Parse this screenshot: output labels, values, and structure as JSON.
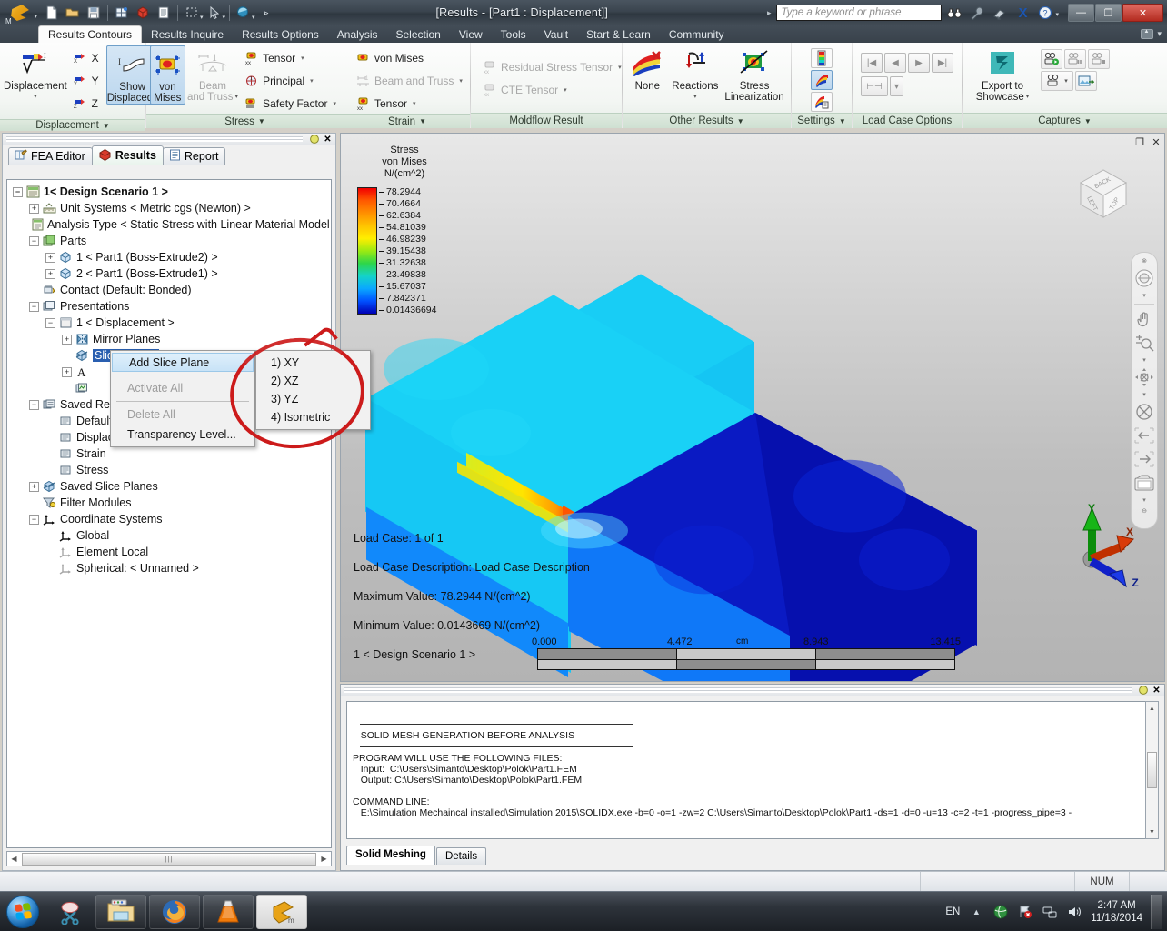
{
  "window": {
    "title": "[Results - [Part1 : Displacement]]",
    "app_icon": "autodesk-logo",
    "minimize_label": "—",
    "restore_label": "❐",
    "close_label": "✕"
  },
  "quick_access": [
    {
      "name": "new-file-icon",
      "glyph": "🗋"
    },
    {
      "name": "open-file-icon",
      "glyph": "🗁"
    },
    {
      "name": "save-icon",
      "glyph": "💾"
    },
    {
      "name": "mesh-icon",
      "glyph": "▦"
    },
    {
      "name": "model-cube-icon",
      "glyph": "◼"
    },
    {
      "name": "report-icon",
      "glyph": "▤"
    },
    {
      "name": "select-rect-icon",
      "glyph": "⬚"
    },
    {
      "name": "select-arrow-icon",
      "glyph": "➤"
    },
    {
      "name": "analysis-icon",
      "glyph": "◕"
    }
  ],
  "search": {
    "placeholder": "Type a keyword or phrase",
    "icons": [
      "binoculars-icon",
      "wrench-icon",
      "satellite-icon",
      "exchange-icon",
      "help-icon"
    ]
  },
  "ribbon_tabs": [
    {
      "label": "Results Contours",
      "active": true
    },
    {
      "label": "Results Inquire",
      "active": false
    },
    {
      "label": "Results Options",
      "active": false
    },
    {
      "label": "Analysis",
      "active": false
    },
    {
      "label": "Selection",
      "active": false
    },
    {
      "label": "View",
      "active": false
    },
    {
      "label": "Tools",
      "active": false
    },
    {
      "label": "Vault",
      "active": false
    },
    {
      "label": "Start & Learn",
      "active": false
    },
    {
      "label": "Community",
      "active": false
    }
  ],
  "ribbon_groups": {
    "displacement": {
      "title": "Displacement",
      "main_button": "Displacement",
      "axes": [
        "X",
        "Y",
        "Z"
      ],
      "show_displaced": "Show\nDisplaced",
      "show_displaced_line1": "Show",
      "show_displaced_line2": "Displaced"
    },
    "stress": {
      "title": "Stress",
      "von_mises_l1": "von",
      "von_mises_l2": "Mises",
      "beam_truss_l1": "Beam",
      "beam_truss_l2": "and Truss",
      "items": [
        "Tensor",
        "Principal",
        "Safety Factor"
      ]
    },
    "strain": {
      "title": "Strain",
      "items": [
        "von Mises",
        "Beam and Truss",
        "Tensor"
      ]
    },
    "moldflow": {
      "title": "Moldflow Result",
      "items": [
        "Residual Stress Tensor",
        "CTE Tensor"
      ]
    },
    "other_results": {
      "title": "Other Results",
      "none": "None",
      "reactions": "Reactions",
      "stress_lin_l1": "Stress",
      "stress_lin_l2": "Linearization"
    },
    "settings": {
      "title": "Settings"
    },
    "load_case_options": {
      "title": "Load Case Options"
    },
    "captures": {
      "title": "Captures",
      "export_l1": "Export to",
      "export_l2": "Showcase"
    }
  },
  "tree_panel": {
    "tabs": [
      {
        "label": "FEA Editor",
        "icon": "fea-editor-icon",
        "active": false
      },
      {
        "label": "Results",
        "icon": "results-cube-icon",
        "active": true
      },
      {
        "label": "Report",
        "icon": "report-icon",
        "active": false
      }
    ],
    "nodes": [
      {
        "label": "1< Design Scenario 1 >",
        "indent": 0,
        "expander": "-",
        "icon": "scenario-icon",
        "bold": true
      },
      {
        "label": "Unit Systems < Metric cgs (Newton) >",
        "indent": 1,
        "expander": "+",
        "icon": "units-icon"
      },
      {
        "label": "Analysis Type < Static Stress with Linear Material Model",
        "indent": 1,
        "expander": "",
        "icon": "analysis-type-icon"
      },
      {
        "label": "Parts",
        "indent": 1,
        "expander": "-",
        "icon": "parts-icon"
      },
      {
        "label": "1 < Part1 (Boss-Extrude2) >",
        "indent": 2,
        "expander": "+",
        "icon": "part-cube-icon"
      },
      {
        "label": "2 < Part1 (Boss-Extrude1) >",
        "indent": 2,
        "expander": "+",
        "icon": "part-cube-icon"
      },
      {
        "label": "Contact (Default: Bonded)",
        "indent": 1,
        "expander": "",
        "icon": "contact-icon"
      },
      {
        "label": "Presentations",
        "indent": 1,
        "expander": "-",
        "icon": "presentations-icon"
      },
      {
        "label": "1 < Displacement >",
        "indent": 2,
        "expander": "-",
        "icon": "presentation-icon"
      },
      {
        "label": "Mirror Planes",
        "indent": 3,
        "expander": "+",
        "icon": "mirror-planes-icon"
      },
      {
        "label": "Slice Planes",
        "indent": 3,
        "expander": "",
        "icon": "slice-planes-icon",
        "selected": true
      },
      {
        "label": "",
        "indent": 3,
        "expander": "+",
        "icon": "text-a-icon"
      },
      {
        "label": "",
        "indent": 3,
        "expander": "",
        "icon": "graph-icon"
      },
      {
        "label": "Saved Reports",
        "indent": 1,
        "expander": "-",
        "icon": "saved-reports-icon"
      },
      {
        "label": "Default",
        "indent": 2,
        "expander": "",
        "icon": "report-item-icon"
      },
      {
        "label": "Displacement",
        "indent": 2,
        "expander": "",
        "icon": "report-item-icon"
      },
      {
        "label": "Strain",
        "indent": 2,
        "expander": "",
        "icon": "report-item-icon"
      },
      {
        "label": "Stress",
        "indent": 2,
        "expander": "",
        "icon": "report-item-icon"
      },
      {
        "label": "Saved Slice Planes",
        "indent": 1,
        "expander": "+",
        "icon": "slice-planes-icon"
      },
      {
        "label": "Filter Modules",
        "indent": 1,
        "expander": "",
        "icon": "filter-icon"
      },
      {
        "label": "Coordinate Systems",
        "indent": 1,
        "expander": "-",
        "icon": "coord-sys-icon"
      },
      {
        "label": "Global",
        "indent": 2,
        "expander": "",
        "icon": "coord-sys-icon"
      },
      {
        "label": "Element Local",
        "indent": 2,
        "expander": "",
        "icon": "coord-sys-gray-icon"
      },
      {
        "label": "Spherical: < Unnamed >",
        "indent": 2,
        "expander": "",
        "icon": "coord-sys-gray-icon"
      }
    ]
  },
  "context_menu": {
    "items": [
      {
        "label": "Add Slice Plane",
        "highlighted": true,
        "disabled": false,
        "accel": "S"
      },
      {
        "separator": true
      },
      {
        "label": "Activate All",
        "highlighted": false,
        "disabled": true,
        "accel": "A"
      },
      {
        "separator": true
      },
      {
        "label": "Delete All",
        "highlighted": false,
        "disabled": true,
        "accel": "l"
      },
      {
        "label": "Transparency Level...",
        "highlighted": false,
        "disabled": false
      }
    ],
    "submenu": [
      {
        "label": "1) XY"
      },
      {
        "label": "2) XZ"
      },
      {
        "label": "3) YZ"
      },
      {
        "label": "4) Isometric"
      }
    ],
    "annotation_color": "#cc1b1b"
  },
  "viewport": {
    "legend": {
      "title_lines": [
        "Stress",
        "von Mises",
        "N/(cm^2)"
      ],
      "ticks": [
        "78.2944",
        "70.4664",
        "62.6384",
        "54.81039",
        "46.98239",
        "39.15438",
        "31.32638",
        "23.49838",
        "15.67037",
        "7.842371",
        "0.01436694"
      ],
      "colors_top_to_bottom": [
        "#f20000",
        "#ff7a00",
        "#ffc400",
        "#ffee00",
        "#9bea12",
        "#2dd64a",
        "#14d3c8",
        "#0aa8ff",
        "#0050ff",
        "#0000b4"
      ]
    },
    "info": [
      "Load Case:  1 of 1",
      "Load Case Description:  Load Case Description",
      "Maximum Value: 78.2944 N/(cm^2)",
      "Minimum Value: 0.0143669 N/(cm^2)",
      "1 < Design Scenario 1 >"
    ],
    "ruler": {
      "unit": "cm",
      "labels": [
        "0.000",
        "4.472",
        "8.943",
        "13.415"
      ]
    },
    "viewcube": {
      "faces": [
        "TOP",
        "LEFT",
        "BACK"
      ]
    },
    "triad": {
      "axes": [
        "X",
        "Y",
        "Z"
      ],
      "x_color": "#b01b00",
      "y_color": "#009b00",
      "z_color": "#0028d8"
    },
    "nav_tools": [
      "steering-wheel-icon",
      "pan-hand-icon",
      "zoom-magnifier-icon",
      "orbit-icon",
      "fit-all-icon",
      "back-arrow-icon",
      "forward-arrow-icon",
      "camera-icon"
    ]
  },
  "log_panel": {
    "lines": [
      "",
      "   SOLID MESH GENERATION BEFORE ANALYSIS",
      "",
      "PROGRAM WILL USE THE FOLLOWING FILES:",
      "   Input:  C:\\Users\\Simanto\\Desktop\\Polok\\Part1.FEM",
      "   Output: C:\\Users\\Simanto\\Desktop\\Polok\\Part1.FEM",
      "",
      "COMMAND LINE:",
      "   E:\\Simulation Mechaincal installed\\Simulation 2015\\SOLIDX.exe -b=0 -o=1 -zw=2 C:\\Users\\Simanto\\Desktop\\Polok\\Part1 -ds=1 -d=0 -u=13 -c=2 -t=1 -progress_pipe=3 -"
    ],
    "tabs": [
      {
        "label": "Solid Meshing",
        "active": true
      },
      {
        "label": "Details",
        "active": false
      }
    ]
  },
  "status_bar": {
    "num_lock": "NUM"
  },
  "taskbar": {
    "start": "start-orb",
    "items": [
      {
        "name": "snipping-tool-icon"
      },
      {
        "name": "file-explorer-icon"
      },
      {
        "name": "firefox-icon"
      },
      {
        "name": "vlc-icon"
      },
      {
        "name": "autodesk-simulation-icon"
      }
    ],
    "tray": {
      "language": "EN",
      "icons": [
        "show-hidden-icon",
        "network-globe-icon",
        "flag-action-icon",
        "network-icon",
        "volume-icon"
      ],
      "time": "2:47 AM",
      "date": "11/18/2014"
    }
  }
}
